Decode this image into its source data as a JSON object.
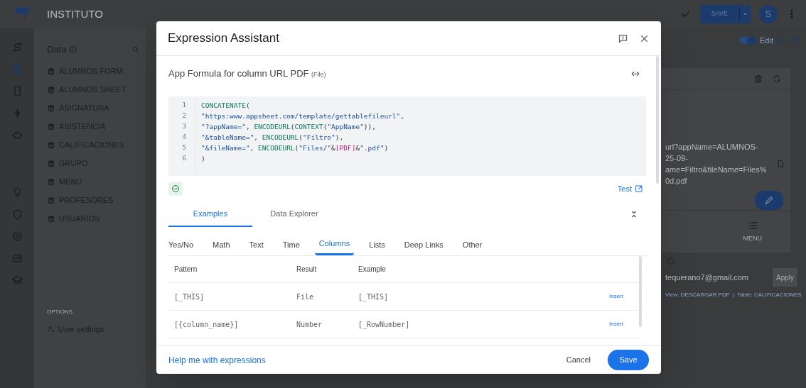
{
  "app": {
    "title": "INSTITUTO",
    "toolbar": {
      "save": "SAVE",
      "avatar": "S"
    },
    "sidebar": {
      "title": "Data",
      "tables": [
        "ALUMNOS FORM",
        "ALUMNOS SHEET",
        "ASIGNATURA",
        "ASISTENCIA",
        "CALIFICACIONES",
        "GRUPO",
        "MENU",
        "PROFESORES",
        "USUARIOS"
      ],
      "options_label": "OPTIONS",
      "user_settings": "User settings"
    },
    "edit_toggle": {
      "label": "Edit",
      "on": true
    },
    "preview": {
      "url_lines": [
        "url?appName=ALUMNOS-",
        "25-09-",
        "ame=Filtro&fileName=Files%",
        "0d.pdf"
      ],
      "menu_label": "MENU",
      "email": "tequerano7@gmail.com",
      "apply": "Apply",
      "footer": "View: DESCARGAR PDF  |  Table: CALIFICACIONES"
    }
  },
  "dialog": {
    "title": "Expression Assistant",
    "subtitle": "App Formula for column URL PDF",
    "subtitle_type": "(File)",
    "code_lines": [
      {
        "number": "1",
        "tokens": [
          {
            "text": "CONCATENATE",
            "kind": "fn"
          },
          {
            "text": "(",
            "kind": "punct"
          }
        ]
      },
      {
        "number": "2",
        "tokens": [
          {
            "text": "\"https:www.appsheet.com/template/gettablefileurl\"",
            "kind": "str"
          },
          {
            "text": ",",
            "kind": "punct"
          }
        ]
      },
      {
        "number": "3",
        "tokens": [
          {
            "text": "\"?appName=\"",
            "kind": "str"
          },
          {
            "text": ", ",
            "kind": "punct"
          },
          {
            "text": "ENCODEURL",
            "kind": "fn"
          },
          {
            "text": "(",
            "kind": "punct"
          },
          {
            "text": "CONTEXT",
            "kind": "fn"
          },
          {
            "text": "(",
            "kind": "punct"
          },
          {
            "text": "\"AppName\"",
            "kind": "str"
          },
          {
            "text": ")),",
            "kind": "punct"
          }
        ]
      },
      {
        "number": "4",
        "tokens": [
          {
            "text": "\"&tableName=\"",
            "kind": "str"
          },
          {
            "text": ", ",
            "kind": "punct"
          },
          {
            "text": "ENCODEURL",
            "kind": "fn"
          },
          {
            "text": "(",
            "kind": "punct"
          },
          {
            "text": "\"Filtro\"",
            "kind": "str"
          },
          {
            "text": "),",
            "kind": "punct"
          }
        ]
      },
      {
        "number": "5",
        "tokens": [
          {
            "text": "\"&fileName=\"",
            "kind": "str"
          },
          {
            "text": ", ",
            "kind": "punct"
          },
          {
            "text": "ENCODEURL",
            "kind": "fn"
          },
          {
            "text": "(",
            "kind": "punct"
          },
          {
            "text": "\"Files/\"",
            "kind": "str"
          },
          {
            "text": "&",
            "kind": "punct"
          },
          {
            "text": "[PDF]",
            "kind": "field"
          },
          {
            "text": "&",
            "kind": "punct"
          },
          {
            "text": "\".pdf\"",
            "kind": "str"
          },
          {
            "text": ")",
            "kind": "punct"
          }
        ]
      },
      {
        "number": "6",
        "tokens": [
          {
            "text": ")",
            "kind": "punct"
          }
        ]
      }
    ],
    "valid": true,
    "test": "Test",
    "tabs": [
      {
        "label": "Examples",
        "selected": true
      },
      {
        "label": "Data Explorer",
        "selected": false
      }
    ],
    "categories": [
      {
        "label": "Yes/No",
        "selected": false
      },
      {
        "label": "Math",
        "selected": false
      },
      {
        "label": "Text",
        "selected": false
      },
      {
        "label": "Time",
        "selected": false
      },
      {
        "label": "Columns",
        "selected": true
      },
      {
        "label": "Lists",
        "selected": false
      },
      {
        "label": "Deep Links",
        "selected": false
      },
      {
        "label": "Other",
        "selected": false
      }
    ],
    "table": {
      "columns": [
        "Pattern",
        "Result",
        "Example"
      ],
      "rows": [
        {
          "pattern": "[_THIS]",
          "result": "File",
          "example": "[_THIS]",
          "action": "Insert"
        },
        {
          "pattern": "[{column_name}]",
          "result": "Number",
          "example": "[_RowNumber]",
          "action": "Insert"
        }
      ]
    },
    "help": "Help me with expressions",
    "cancel": "Cancel",
    "save": "Save"
  }
}
